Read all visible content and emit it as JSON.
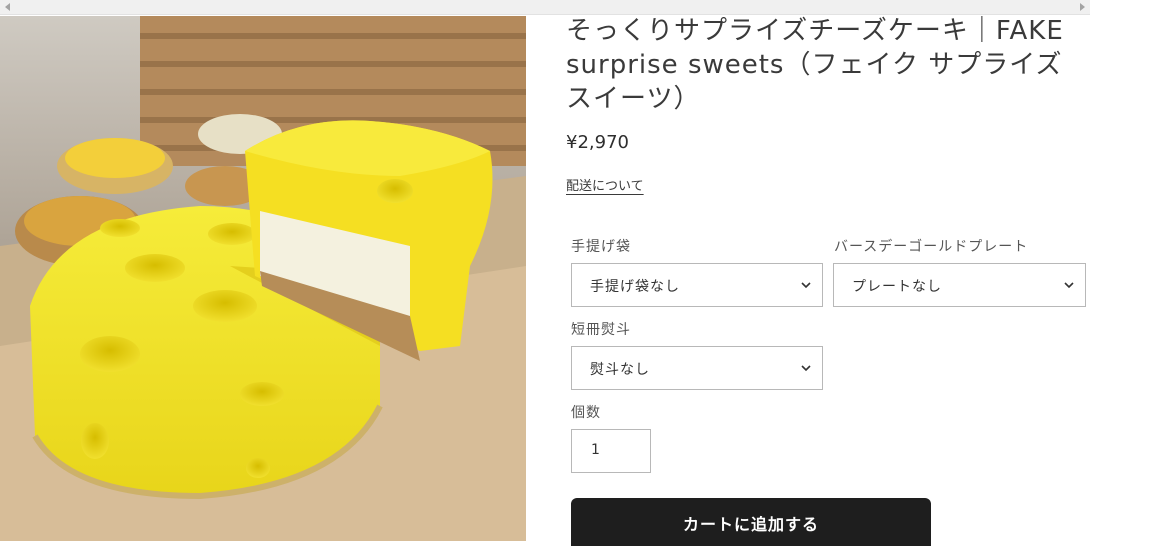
{
  "product": {
    "title": "そっくりサプライズチーズケーキ｜FAKE surprise sweets（フェイク サプライズ スイーツ）",
    "price": "¥2,970",
    "shipping_link": "配送について"
  },
  "options": {
    "bag": {
      "label": "手提げ袋",
      "value": "手提げ袋なし"
    },
    "plate": {
      "label": "バースデーゴールドプレート",
      "value": "プレートなし"
    },
    "noshi": {
      "label": "短冊熨斗",
      "value": "熨斗なし"
    }
  },
  "quantity": {
    "label": "個数",
    "value": "1"
  },
  "cart_button": "カートに追加する"
}
